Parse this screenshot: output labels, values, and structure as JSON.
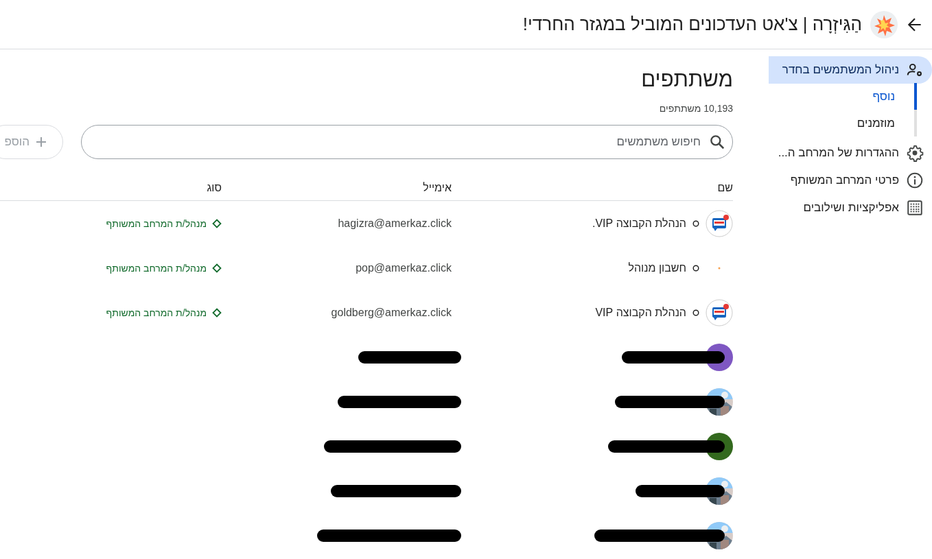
{
  "header": {
    "title": "הַגִּיזְרָה | צ'אט העדכונים המוביל במגזר החרדי!"
  },
  "sidebar": {
    "items": [
      {
        "label": "ניהול המשתמשים בחדר",
        "kind": "manage-users",
        "selected": true,
        "children": [
          {
            "label": "נוסף",
            "selected": true
          },
          {
            "label": "מוזמנים",
            "selected": false
          }
        ]
      },
      {
        "label": "ההגדרות של המרחב ה...",
        "kind": "settings",
        "selected": false
      },
      {
        "label": "פרטי המרחב המשותף",
        "kind": "info",
        "selected": false
      },
      {
        "label": "אפליקציות ושילובים",
        "kind": "apps",
        "selected": false
      }
    ]
  },
  "main": {
    "title": "משתתפים",
    "count": "10,193 משתתפים",
    "search": {
      "placeholder": "חיפוש משתמשים"
    },
    "add_button": "הוספ",
    "table": {
      "columns": [
        "שם",
        "אימייל",
        "סוג"
      ],
      "rows": [
        {
          "kind": "member",
          "avatar": {
            "kind": "logo"
          },
          "name": "הנהלת הקבוצה VIP.",
          "email": "hagizra@amerkaz.click",
          "role": "מנהל/ת המרחב המשותף"
        },
        {
          "kind": "member",
          "avatar": {
            "kind": "blank"
          },
          "name": "חשבון מנוהל",
          "email": "pop@amerkaz.click",
          "role": "מנהל/ת המרחב המשותף"
        },
        {
          "kind": "member",
          "avatar": {
            "kind": "logo"
          },
          "name": "הנהלת הקבוצה VIP",
          "email": "goldberg@amerkaz.click",
          "role": "מנהל/ת המרחב המשותף"
        },
        {
          "kind": "redacted",
          "avatar": {
            "kind": "initial"
          },
          "color": "#7e57c2"
        },
        {
          "kind": "redacted"
        },
        {
          "kind": "redacted",
          "avatar": {
            "kind": "initial"
          },
          "color": "#33691e"
        },
        {
          "kind": "redacted"
        },
        {
          "kind": "redacted"
        }
      ]
    }
  }
}
